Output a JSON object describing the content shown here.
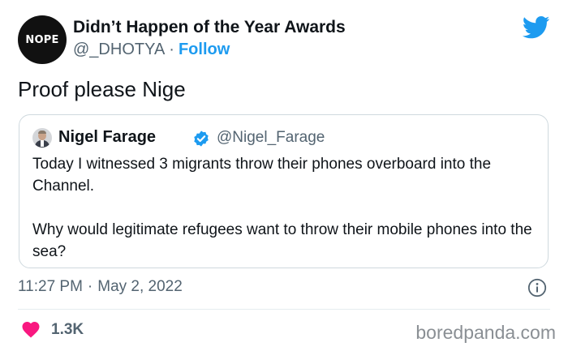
{
  "author": {
    "avatar_text": "NOPE",
    "display_name": "Didn’t Happen of the Year Awards",
    "handle": "@_DHOTYA",
    "separator": "·",
    "follow_label": "Follow"
  },
  "tweet": {
    "text": "Proof please Nige"
  },
  "quoted_tweet": {
    "display_name": "Nigel Farage",
    "handle": "@Nigel_Farage",
    "verified": true,
    "paragraphs": [
      "Today I witnessed 3 migrants throw their phones overboard into the Channel.",
      "Why would legitimate refugees want to throw their mobile phones into the sea?"
    ]
  },
  "meta": {
    "time": "11:27 PM",
    "separator": "·",
    "date": "May 2, 2022"
  },
  "engagement": {
    "likes": "1.3K"
  },
  "watermark": "boredpanda.com",
  "icons": {
    "brand": "twitter-bird-icon",
    "verified": "verified-badge-icon",
    "info": "info-icon",
    "like": "heart-icon"
  },
  "colors": {
    "accent": "#1d9bf0",
    "like": "#f91880",
    "text_primary": "#0f1419",
    "text_secondary": "#536471",
    "border": "#cfd9de",
    "avatar_bg": "#111111"
  }
}
